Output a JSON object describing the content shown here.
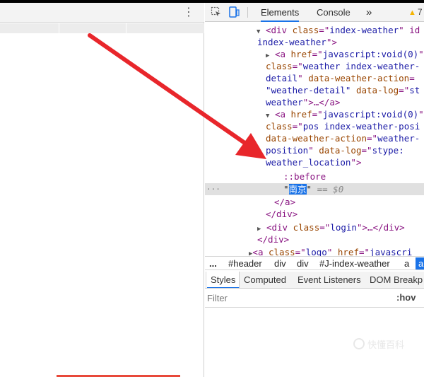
{
  "devtools": {
    "tabs": [
      {
        "label": "Elements",
        "active": true
      },
      {
        "label": "Console",
        "active": false
      }
    ],
    "more_tabs_glyph": "»",
    "warning_count": "7"
  },
  "dom_tree": {
    "line1": {
      "open": "<div ",
      "attr1": "class",
      "eq": "=\"",
      "val1": "index-weather",
      "rest": "\" id"
    },
    "line2": {
      "val": "index-weather",
      "close": "\">"
    },
    "line3": {
      "open": "<a ",
      "attr": "href",
      "eq": "=\"",
      "val": "javascript:void(0)",
      "rest": "\""
    },
    "line4": {
      "attr": "class",
      "eq": "=\"",
      "val": "weather index-weather-"
    },
    "line5": {
      "val": "detail",
      "q": "\" ",
      "attr": "data-weather-action",
      "eq": "="
    },
    "line6": {
      "val": "\"weather-detail\"",
      "sp": " ",
      "attr": "data-log",
      "eq": "=\"",
      "val2": "st"
    },
    "line7": {
      "val": "weather",
      "close": "\">…</a>"
    },
    "line8": {
      "open": "<a ",
      "attr": "href",
      "eq": "=\"",
      "val": "javascript:void(0)",
      "rest": "\""
    },
    "line9": {
      "attr": "class",
      "eq": "=\"",
      "val": "pos index-weather-posi"
    },
    "line10": {
      "attr": "data-weather-action",
      "eq": "=\"",
      "val": "weather-"
    },
    "line11": {
      "val": "position",
      "q": "\" ",
      "attr": "data-log",
      "eq": "=\"",
      "val2": "stype:"
    },
    "line12": {
      "val": "weather_location",
      "close": "\">"
    },
    "line13": {
      "pseudo": "::before"
    },
    "line14": {
      "quote_open": "\"",
      "text": "南京",
      "quote_close": "\"",
      "suffix": " == $0"
    },
    "line15": {
      "close": "</a>"
    },
    "line16": {
      "close": "</div>"
    },
    "line17": {
      "open": "<div ",
      "attr": "class",
      "eq": "=\"",
      "val": "login",
      "close": "\">…</div>"
    },
    "line18": {
      "close": "</div>"
    },
    "line19": {
      "open": "<a ",
      "attr": "class",
      "eq": "=\"",
      "val": "logo",
      "q": "\" ",
      "attr2": "href",
      "eq2": "=\"",
      "val2": "javascri"
    },
    "ellipsis": "···"
  },
  "breadcrumbs": [
    "...",
    "#header",
    "div",
    "div",
    "#J-index-weather",
    "a",
    "a"
  ],
  "subtabs": [
    "Styles",
    "Computed",
    "Event Listeners",
    "DOM Breakp"
  ],
  "filter": {
    "placeholder": "Filter",
    "hov": ":hov"
  },
  "watermark": {
    "text": "快懂百科"
  },
  "colors": {
    "accent": "#1a73e8",
    "arrow": "#e8262b",
    "tag": "#881280",
    "attr": "#994500",
    "value": "#1a1aa6"
  }
}
